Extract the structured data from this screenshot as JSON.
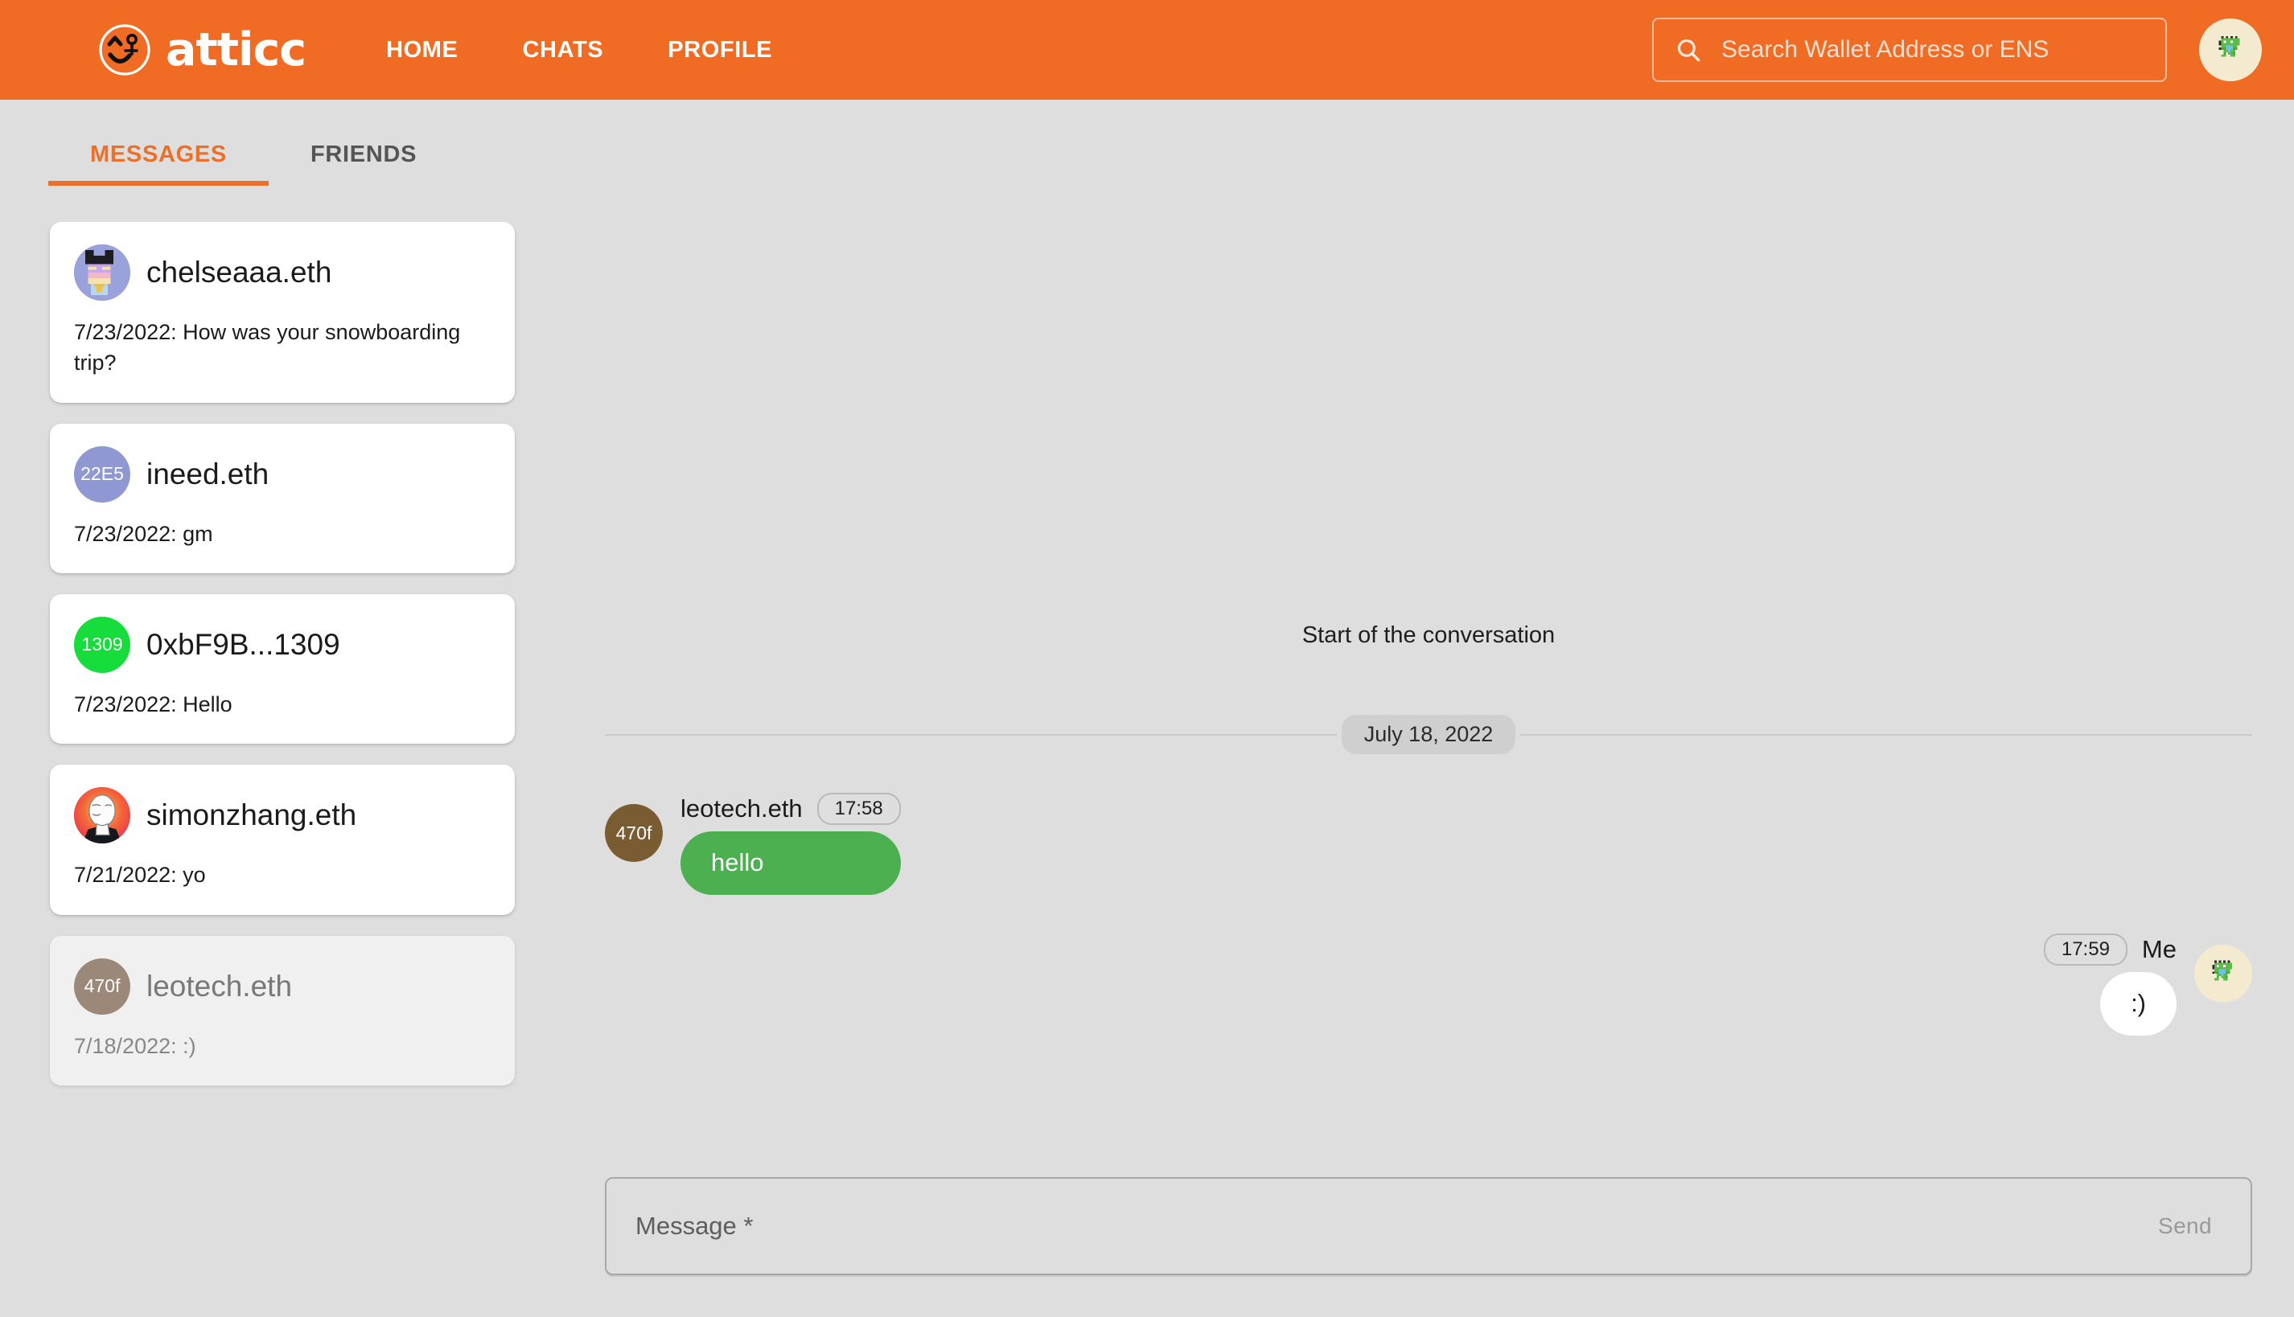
{
  "header": {
    "brand_name": "atticc",
    "logo_icon": "atticc-smiley-logo",
    "nav": [
      {
        "label": "HOME",
        "name": "home"
      },
      {
        "label": "CHATS",
        "name": "chats"
      },
      {
        "label": "PROFILE",
        "name": "profile"
      }
    ],
    "search": {
      "placeholder": "Search Wallet Address or ENS",
      "value": "",
      "icon": "search-icon"
    },
    "account_avatar": {
      "icon": "pixel-creature-avatar",
      "background": "#f3ead0"
    },
    "background_color": "#f06c24"
  },
  "sidebar": {
    "tabs": [
      {
        "label": "MESSAGES",
        "active": true
      },
      {
        "label": "FRIENDS",
        "active": false
      }
    ],
    "conversations": [
      {
        "name": "chelseaaa.eth",
        "preview": "7/23/2022: How was your snowboarding trip?",
        "avatar_type": "image",
        "avatar_initials": "",
        "avatar_color": "#8a92d0",
        "selected": false
      },
      {
        "name": "ineed.eth",
        "preview": "7/23/2022: gm",
        "avatar_type": "initials",
        "avatar_initials": "22E5",
        "avatar_color": "#9098d4",
        "selected": false
      },
      {
        "name": "0xbF9B...1309",
        "preview": "7/23/2022: Hello",
        "avatar_type": "initials",
        "avatar_initials": "1309",
        "avatar_color": "#17dd3c",
        "selected": false
      },
      {
        "name": "simonzhang.eth",
        "preview": "7/21/2022: yo",
        "avatar_type": "image2",
        "avatar_initials": "",
        "avatar_color": "#ef5a3c",
        "selected": false
      },
      {
        "name": "leotech.eth",
        "preview": "7/18/2022: :)",
        "avatar_type": "initials",
        "avatar_initials": "470f",
        "avatar_color": "#9b8878",
        "selected": true
      }
    ]
  },
  "chat": {
    "start_label": "Start of the conversation",
    "date_divider": "July 18, 2022",
    "messages": [
      {
        "direction": "incoming",
        "author": "leotech.eth",
        "time": "17:58",
        "text": "hello",
        "avatar_initials": "470f",
        "avatar_color": "#7a5c33",
        "bubble_color": "#4caf50"
      },
      {
        "direction": "outgoing",
        "author": "Me",
        "time": "17:59",
        "text": ":)",
        "avatar_initials": "",
        "avatar_color": "#f3ead0",
        "bubble_color": "#ffffff"
      }
    ],
    "composer": {
      "placeholder": "Message *",
      "value": "",
      "send_label": "Send"
    }
  },
  "theme": {
    "accent": "#f06c24",
    "page_background": "#dedede",
    "bubble_them": "#4caf50",
    "bubble_me": "#ffffff"
  }
}
